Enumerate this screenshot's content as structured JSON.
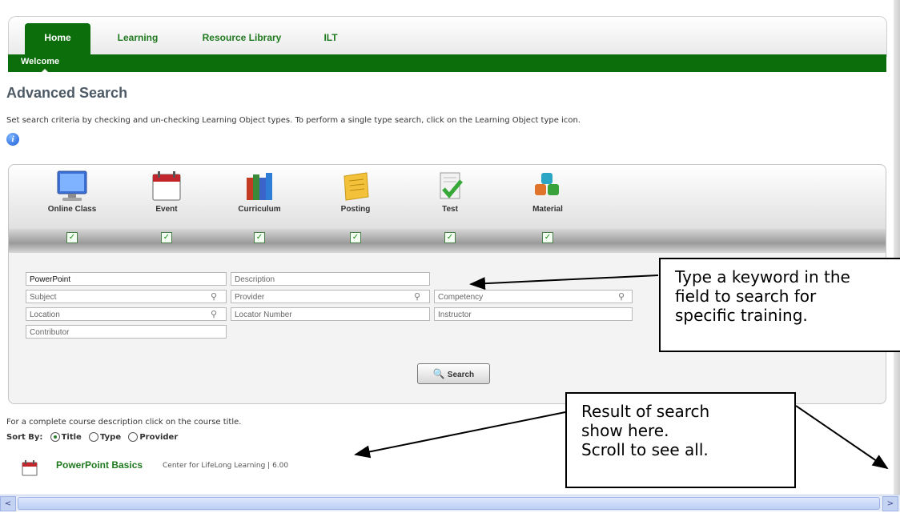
{
  "nav": {
    "tabs": [
      {
        "label": "Home"
      },
      {
        "label": "Learning"
      },
      {
        "label": "Resource Library"
      },
      {
        "label": "ILT"
      }
    ],
    "subnav_label": "Welcome"
  },
  "page": {
    "title": "Advanced Search",
    "description": "Set search criteria by checking and un-checking Learning Object types. To perform a single type search, click on the Learning Object type icon.",
    "info_icon": "info-icon"
  },
  "object_types": [
    {
      "label": "Online Class",
      "icon": "monitor-icon",
      "checked": true
    },
    {
      "label": "Event",
      "icon": "calendar-icon",
      "checked": true
    },
    {
      "label": "Curriculum",
      "icon": "books-icon",
      "checked": true
    },
    {
      "label": "Posting",
      "icon": "notepad-icon",
      "checked": true
    },
    {
      "label": "Test",
      "icon": "checklist-icon",
      "checked": true
    },
    {
      "label": "Material",
      "icon": "cubes-icon",
      "checked": true
    }
  ],
  "fields": {
    "keyword": "PowerPoint",
    "description": "Description",
    "subject": "Subject",
    "provider": "Provider",
    "competency": "Competency",
    "location": "Location",
    "locator_number": "Locator Number",
    "instructor": "Instructor",
    "contributor": "Contributor"
  },
  "search_button": "Search",
  "results": {
    "hint": "For a complete course description click on the course title.",
    "sort_label": "Sort By:",
    "sort_options": [
      "Title",
      "Type",
      "Provider"
    ],
    "sort_selected": "Title",
    "items": [
      {
        "title": "PowerPoint Basics",
        "provider": "Center for LifeLong Learning | 6.00",
        "icon": "calendar-icon"
      }
    ]
  },
  "callouts": {
    "keyword": [
      "Type a keyword in the",
      "field to search for",
      "specific training."
    ],
    "results": [
      "Result of search",
      "show here.",
      "Scroll to see all."
    ]
  },
  "scrollbar": {
    "left_arrow": "<",
    "right_arrow": ">"
  }
}
